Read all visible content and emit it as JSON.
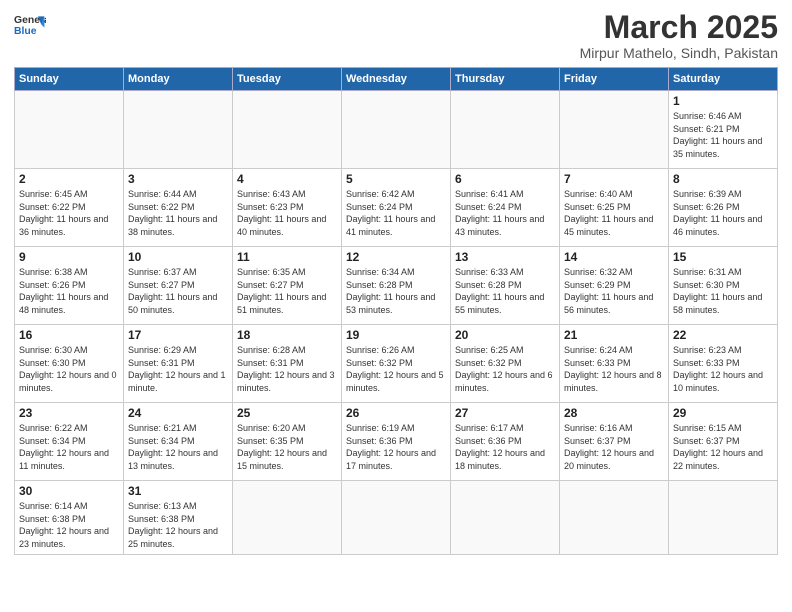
{
  "header": {
    "logo_general": "General",
    "logo_blue": "Blue",
    "month_title": "March 2025",
    "location": "Mirpur Mathelo, Sindh, Pakistan"
  },
  "weekdays": [
    "Sunday",
    "Monday",
    "Tuesday",
    "Wednesday",
    "Thursday",
    "Friday",
    "Saturday"
  ],
  "weeks": [
    [
      {
        "day": "",
        "info": ""
      },
      {
        "day": "",
        "info": ""
      },
      {
        "day": "",
        "info": ""
      },
      {
        "day": "",
        "info": ""
      },
      {
        "day": "",
        "info": ""
      },
      {
        "day": "",
        "info": ""
      },
      {
        "day": "1",
        "info": "Sunrise: 6:46 AM\nSunset: 6:21 PM\nDaylight: 11 hours and 35 minutes."
      }
    ],
    [
      {
        "day": "2",
        "info": "Sunrise: 6:45 AM\nSunset: 6:22 PM\nDaylight: 11 hours and 36 minutes."
      },
      {
        "day": "3",
        "info": "Sunrise: 6:44 AM\nSunset: 6:22 PM\nDaylight: 11 hours and 38 minutes."
      },
      {
        "day": "4",
        "info": "Sunrise: 6:43 AM\nSunset: 6:23 PM\nDaylight: 11 hours and 40 minutes."
      },
      {
        "day": "5",
        "info": "Sunrise: 6:42 AM\nSunset: 6:24 PM\nDaylight: 11 hours and 41 minutes."
      },
      {
        "day": "6",
        "info": "Sunrise: 6:41 AM\nSunset: 6:24 PM\nDaylight: 11 hours and 43 minutes."
      },
      {
        "day": "7",
        "info": "Sunrise: 6:40 AM\nSunset: 6:25 PM\nDaylight: 11 hours and 45 minutes."
      },
      {
        "day": "8",
        "info": "Sunrise: 6:39 AM\nSunset: 6:26 PM\nDaylight: 11 hours and 46 minutes."
      }
    ],
    [
      {
        "day": "9",
        "info": "Sunrise: 6:38 AM\nSunset: 6:26 PM\nDaylight: 11 hours and 48 minutes."
      },
      {
        "day": "10",
        "info": "Sunrise: 6:37 AM\nSunset: 6:27 PM\nDaylight: 11 hours and 50 minutes."
      },
      {
        "day": "11",
        "info": "Sunrise: 6:35 AM\nSunset: 6:27 PM\nDaylight: 11 hours and 51 minutes."
      },
      {
        "day": "12",
        "info": "Sunrise: 6:34 AM\nSunset: 6:28 PM\nDaylight: 11 hours and 53 minutes."
      },
      {
        "day": "13",
        "info": "Sunrise: 6:33 AM\nSunset: 6:28 PM\nDaylight: 11 hours and 55 minutes."
      },
      {
        "day": "14",
        "info": "Sunrise: 6:32 AM\nSunset: 6:29 PM\nDaylight: 11 hours and 56 minutes."
      },
      {
        "day": "15",
        "info": "Sunrise: 6:31 AM\nSunset: 6:30 PM\nDaylight: 11 hours and 58 minutes."
      }
    ],
    [
      {
        "day": "16",
        "info": "Sunrise: 6:30 AM\nSunset: 6:30 PM\nDaylight: 12 hours and 0 minutes."
      },
      {
        "day": "17",
        "info": "Sunrise: 6:29 AM\nSunset: 6:31 PM\nDaylight: 12 hours and 1 minute."
      },
      {
        "day": "18",
        "info": "Sunrise: 6:28 AM\nSunset: 6:31 PM\nDaylight: 12 hours and 3 minutes."
      },
      {
        "day": "19",
        "info": "Sunrise: 6:26 AM\nSunset: 6:32 PM\nDaylight: 12 hours and 5 minutes."
      },
      {
        "day": "20",
        "info": "Sunrise: 6:25 AM\nSunset: 6:32 PM\nDaylight: 12 hours and 6 minutes."
      },
      {
        "day": "21",
        "info": "Sunrise: 6:24 AM\nSunset: 6:33 PM\nDaylight: 12 hours and 8 minutes."
      },
      {
        "day": "22",
        "info": "Sunrise: 6:23 AM\nSunset: 6:33 PM\nDaylight: 12 hours and 10 minutes."
      }
    ],
    [
      {
        "day": "23",
        "info": "Sunrise: 6:22 AM\nSunset: 6:34 PM\nDaylight: 12 hours and 11 minutes."
      },
      {
        "day": "24",
        "info": "Sunrise: 6:21 AM\nSunset: 6:34 PM\nDaylight: 12 hours and 13 minutes."
      },
      {
        "day": "25",
        "info": "Sunrise: 6:20 AM\nSunset: 6:35 PM\nDaylight: 12 hours and 15 minutes."
      },
      {
        "day": "26",
        "info": "Sunrise: 6:19 AM\nSunset: 6:36 PM\nDaylight: 12 hours and 17 minutes."
      },
      {
        "day": "27",
        "info": "Sunrise: 6:17 AM\nSunset: 6:36 PM\nDaylight: 12 hours and 18 minutes."
      },
      {
        "day": "28",
        "info": "Sunrise: 6:16 AM\nSunset: 6:37 PM\nDaylight: 12 hours and 20 minutes."
      },
      {
        "day": "29",
        "info": "Sunrise: 6:15 AM\nSunset: 6:37 PM\nDaylight: 12 hours and 22 minutes."
      }
    ],
    [
      {
        "day": "30",
        "info": "Sunrise: 6:14 AM\nSunset: 6:38 PM\nDaylight: 12 hours and 23 minutes."
      },
      {
        "day": "31",
        "info": "Sunrise: 6:13 AM\nSunset: 6:38 PM\nDaylight: 12 hours and 25 minutes."
      },
      {
        "day": "",
        "info": ""
      },
      {
        "day": "",
        "info": ""
      },
      {
        "day": "",
        "info": ""
      },
      {
        "day": "",
        "info": ""
      },
      {
        "day": "",
        "info": ""
      }
    ]
  ]
}
